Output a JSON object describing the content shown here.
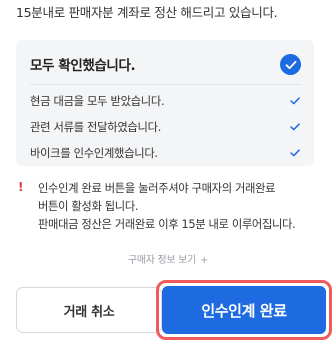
{
  "top_text": "15분내로 판매자분 계좌로 정산 해드리고 있습니다.",
  "confirm_card": {
    "header": "모두 확인했습니다.",
    "items": [
      {
        "label": "현금 대금을 모두 받았습니다."
      },
      {
        "label": "관련 서류를 전달하였습니다."
      },
      {
        "label": "바이크를 인수인계했습니다."
      }
    ]
  },
  "notice": {
    "icon": "!",
    "lines": [
      "인수인계 완료 버튼을 눌러주셔야 구매자의 거래완료",
      "버튼이 활성화 됩니다.",
      "판매대금 정산은 거래완료 이후 15분 내로 이루어집니다."
    ]
  },
  "buyer_info": {
    "label": "구매자 정보 보기",
    "icon": "plus-icon"
  },
  "buttons": {
    "cancel_label": "거래 취소",
    "complete_label": "인수인계 완료"
  },
  "colors": {
    "accent": "#1e6ae0",
    "highlight_outline": "#f05a5a",
    "card_bg": "#f4f5f7",
    "warning": "#e33b3b"
  }
}
